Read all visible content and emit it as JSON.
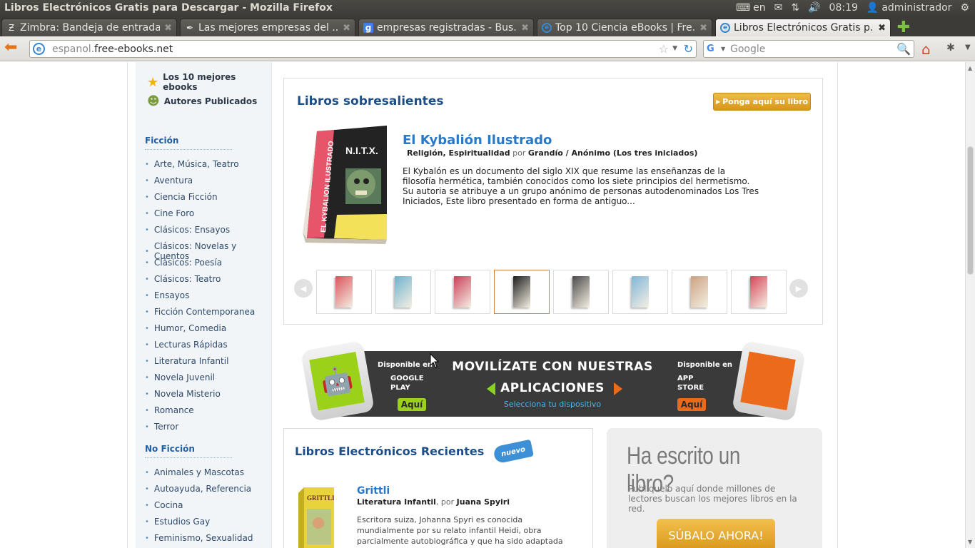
{
  "window": {
    "title": "Libros Electrónicos Gratis para Descargar - Mozilla Firefox",
    "keyboard_layout": "en",
    "clock": "08:19",
    "user": "administrador"
  },
  "tabs": [
    {
      "label": "Zimbra: Bandeja de entrada",
      "icon": "zimbra-icon"
    },
    {
      "label": "Las mejores empresas del ...",
      "icon": "feather-icon"
    },
    {
      "label": "empresas registradas - Bus...",
      "icon": "google-icon"
    },
    {
      "label": "Top 10 Ciencia eBooks | Fre...",
      "icon": "site-icon"
    },
    {
      "label": "Libros Electrónicos Gratis p...",
      "icon": "site-icon",
      "active": true
    }
  ],
  "nav": {
    "url_prefix": "espanol.",
    "url_domain": "free-ebooks.net",
    "search_placeholder": "Google"
  },
  "sidebar": {
    "top_links": [
      {
        "label": "Los 10 mejores ebooks",
        "icon": "star-icon"
      },
      {
        "label": "Autores Publicados",
        "icon": "authors-icon"
      }
    ],
    "fiction_heading": "Ficción",
    "fiction_items": [
      "Arte, Música, Teatro",
      "Aventura",
      "Ciencia Ficción",
      "Cine Foro",
      "Clásicos: Ensayos",
      "Clásicos: Novelas y Cuentos",
      "Clásicos: Poesía",
      "Clásicos: Teatro",
      "Ensayos",
      "Ficción Contemporanea",
      "Humor, Comedia",
      "Lecturas Rápidas",
      "Literatura Infantil",
      "Novela Juvenil",
      "Novela Misterio",
      "Romance",
      "Terror"
    ],
    "nonfiction_heading": "No Ficción",
    "nonfiction_items": [
      "Animales y Mascotas",
      "Autoayuda, Referencia",
      "Cocina",
      "Estudios Gay",
      "Feminismo, Sexualidad"
    ]
  },
  "featured": {
    "section_title": "Libros sobresalientes",
    "add_book_button": "Ponga aquí su libro",
    "book_title": "El Kybalión Ilustrado",
    "book_category": "Religión, Espiritualidad",
    "por": "por",
    "book_author": "Grandío / Anónimo (Los tres iniciados)",
    "book_description": "El Kybalón es un documento del siglo XIX que resume las enseñanzas de la filosofía hermética, también conocidos como los siete principios del hermetismo. Su autoria se atribuye a un grupo anónimo de personas autodenominados Los Tres Iniciados, Este libro presentado en forma de antiguo...",
    "cover_text_vertical": "EL KYBALION ILUSTRADO",
    "cover_text_title": "N.I.T.X.",
    "thumb_colors": [
      "#d9535a",
      "#6fb2cf",
      "#c9405a",
      "#1d1d1d",
      "#4a4a4a",
      "#7fb6d8",
      "#caa282",
      "#d5465a"
    ],
    "selected_thumb": 3
  },
  "banner": {
    "left_available": "Disponible en",
    "left_store": "GOOGLE PLAY",
    "left_button": "Aquí",
    "headline_1": "MOVILÍZATE CON NUESTRAS",
    "headline_2": "APLICACIONES",
    "subtitle": "Selecciona tu dispositivo",
    "right_available": "Disponible en",
    "right_store": "APP STORE",
    "right_button": "Aquí",
    "android_color": "#9bd219",
    "apple_color": "#ec6a1c"
  },
  "recent": {
    "section_title": "Libros Electrónicos Recientes",
    "badge": "nuevo",
    "book_title": "Grittli",
    "book_category": "Literatura Infantil",
    "por": "por",
    "book_author": "Juana Spyiri",
    "book_description": "Escritora suiza, Johanna Spyri es conocida mundialmente por su relato infantil Heidi, obra parcialmente autobiográfica y que ha sido adaptada tanto...",
    "cover_text": "GRITTLI"
  },
  "upload": {
    "heading": "Ha escrito un libro?",
    "text": "Publíquelo aquí donde millones de lectores buscan los mejores libros en la red.",
    "button": "SÚBALO AHORA!"
  }
}
